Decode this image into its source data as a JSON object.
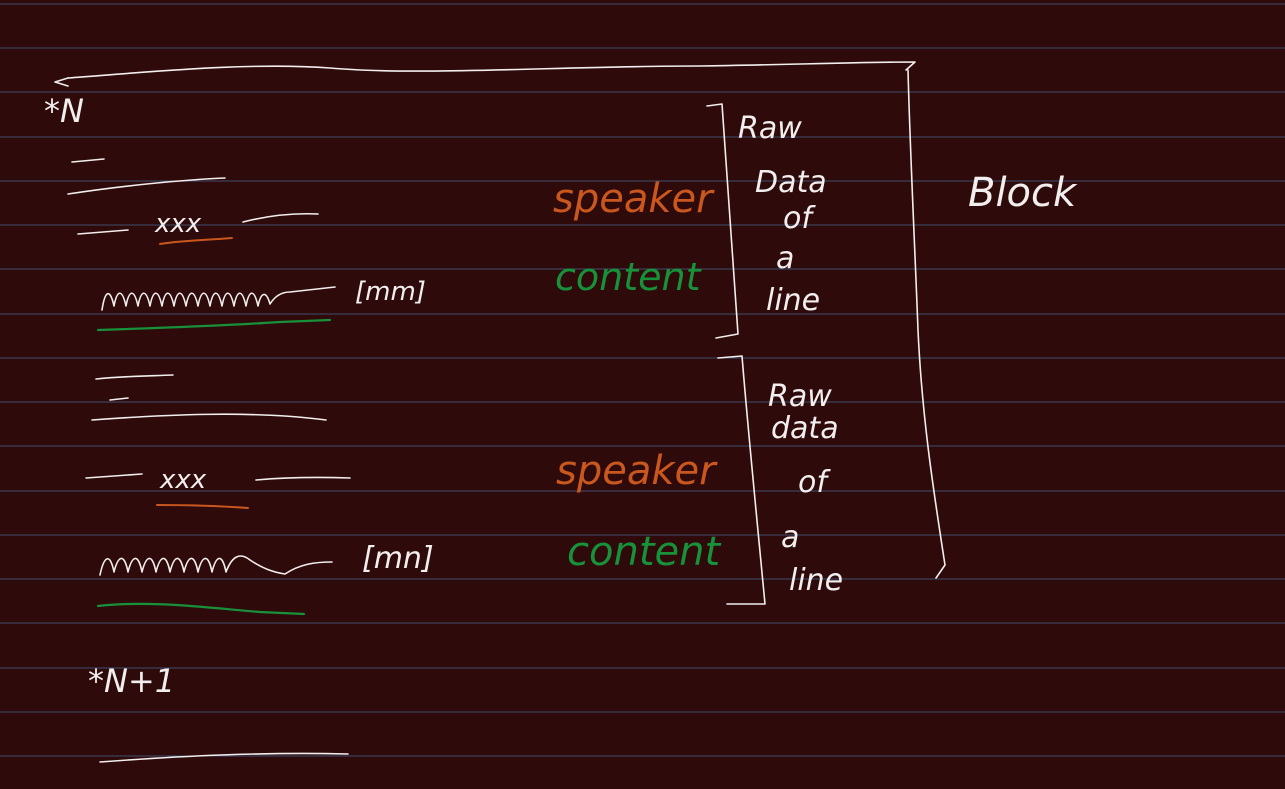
{
  "colors": {
    "background": "#2e0a0a",
    "ruled_lines": "#3d4f6e",
    "white_ink": "#f2eeee",
    "orange_ink": "#c9571e",
    "green_ink": "#17913a"
  },
  "header_marker": "*N",
  "footer_marker": "*N+1",
  "first_line": {
    "speaker": "xxx",
    "bracket": "[mm]",
    "speaker_label": "speaker",
    "content_label": "content",
    "raw_label": [
      "Raw",
      "Data",
      "of",
      "a",
      "line"
    ]
  },
  "second_line": {
    "speaker": "xxx",
    "bracket": "[mn]",
    "speaker_label": "speaker",
    "content_label": "content",
    "raw_label": [
      "Raw",
      "data",
      "of",
      "a",
      "line"
    ]
  },
  "block_label": "Block"
}
